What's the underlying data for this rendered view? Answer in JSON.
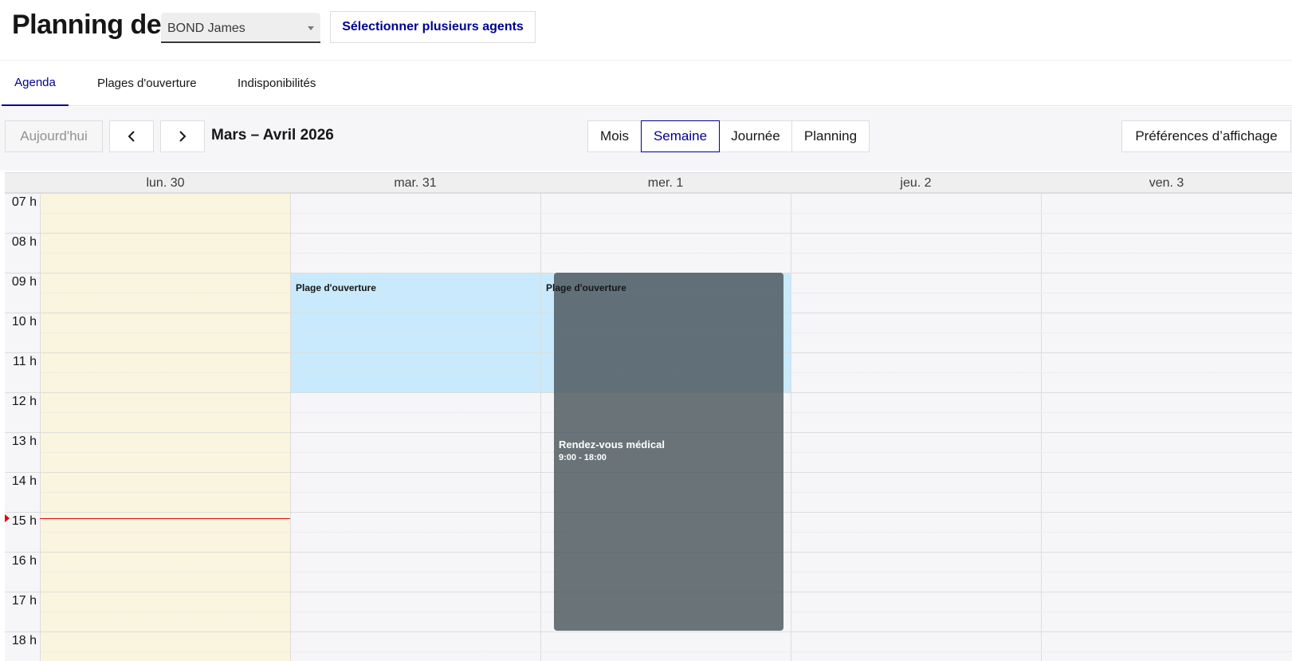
{
  "header": {
    "title": "Planning de",
    "agent_select": {
      "value": "BOND James"
    },
    "multi_agents_button": "Sélectionner plusieurs agents"
  },
  "tabs": [
    {
      "label": "Agenda",
      "active": true
    },
    {
      "label": "Plages d'ouverture",
      "active": false
    },
    {
      "label": "Indisponibilités",
      "active": false
    }
  ],
  "toolbar": {
    "today_label": "Aujourd'hui",
    "prev_icon": "chevron-left-icon",
    "next_icon": "chevron-right-icon",
    "range_title": "Mars – Avril 2026",
    "views": [
      {
        "label": "Mois",
        "active": false
      },
      {
        "label": "Semaine",
        "active": true
      },
      {
        "label": "Journée",
        "active": false
      },
      {
        "label": "Planning",
        "active": false
      }
    ],
    "prefs_label": "Préférences d’affichage"
  },
  "calendar": {
    "days": [
      "lun. 30",
      "mar. 31",
      "mer. 1",
      "jeu. 2",
      "ven. 3"
    ],
    "today_index": 0,
    "hours": [
      "07 h",
      "08 h",
      "09 h",
      "10 h",
      "11 h",
      "12 h",
      "13 h",
      "14 h",
      "15 h",
      "16 h",
      "17 h",
      "18 h"
    ],
    "background_events": [
      {
        "label": "Plage d'ouverture",
        "day_index": 1,
        "start": "09:00",
        "end": "12:00"
      },
      {
        "label": "Plage d'ouverture",
        "day_index": 2,
        "start": "09:00",
        "end": "12:00"
      }
    ],
    "events": [
      {
        "title": "Rendez-vous médical",
        "time": "9:00 - 18:00",
        "day_index": 2,
        "start": "09:00",
        "end": "18:00"
      }
    ],
    "now_time": "15:10"
  },
  "colors": {
    "accent": "#000091",
    "today_bg": "#f9f5de",
    "opening_bg": "#c8eafc",
    "appointment_bg": "#5f6a70",
    "now_indicator": "#e1000f"
  }
}
